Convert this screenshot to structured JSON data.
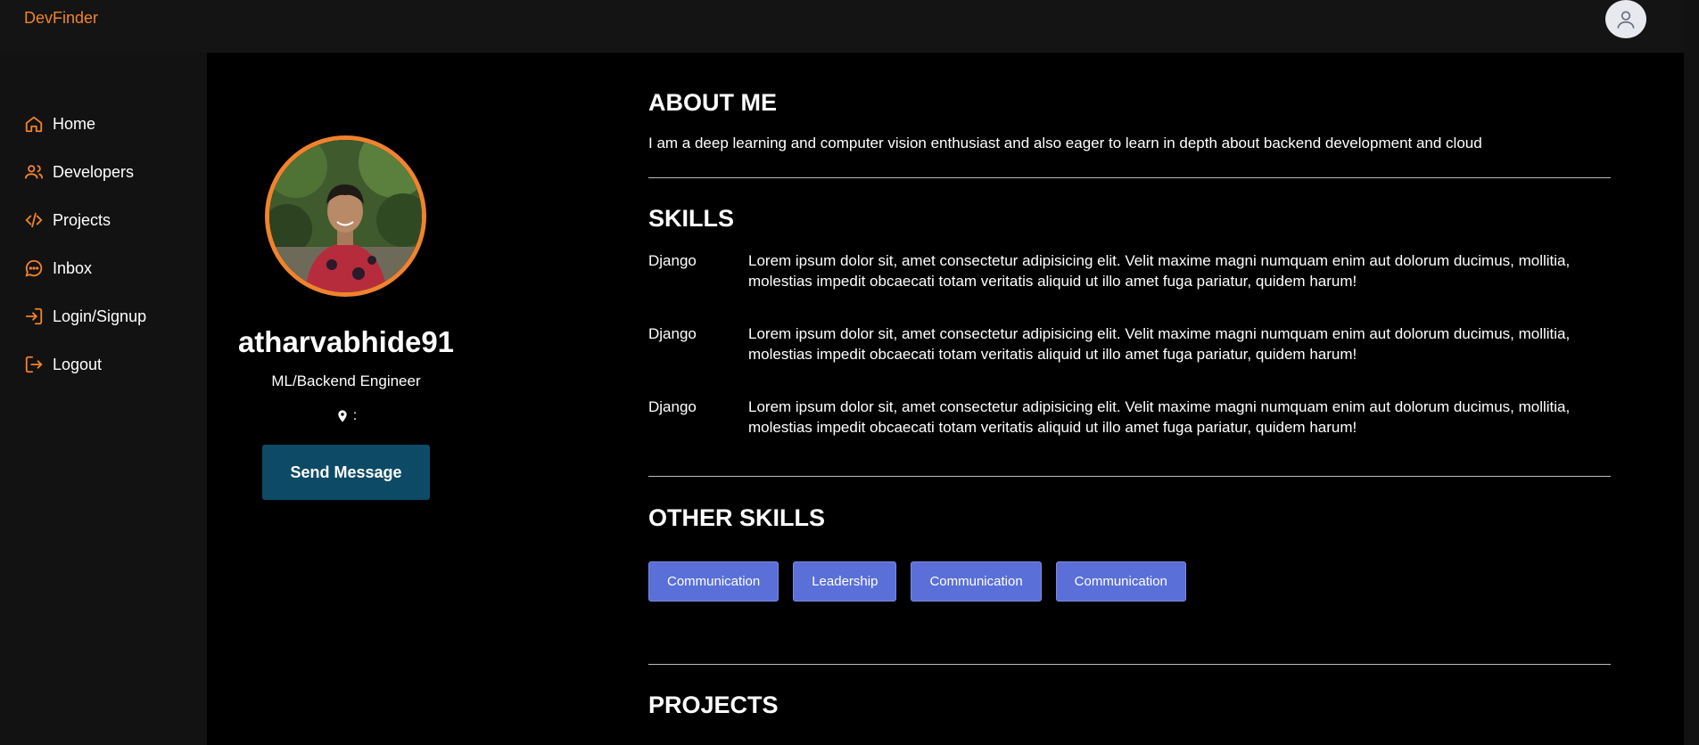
{
  "app": {
    "brand": "DevFinder"
  },
  "sidebar": {
    "items": [
      {
        "label": "Home",
        "icon": "home-icon"
      },
      {
        "label": "Developers",
        "icon": "users-icon"
      },
      {
        "label": "Projects",
        "icon": "code-icon"
      },
      {
        "label": "Inbox",
        "icon": "chat-icon"
      },
      {
        "label": "Login/Signup",
        "icon": "login-icon"
      },
      {
        "label": "Logout",
        "icon": "logout-icon"
      }
    ]
  },
  "profile": {
    "username": "atharvabhide91",
    "role": "ML/Backend Engineer",
    "location": ":",
    "send_button": "Send Message"
  },
  "about": {
    "title": "ABOUT ME",
    "text": "I am a deep learning and computer vision enthusiast and also eager to learn in depth about backend development and cloud"
  },
  "skills": {
    "title": "SKILLS",
    "items": [
      {
        "name": "Django",
        "description": "Lorem ipsum dolor sit, amet consectetur adipisicing elit. Velit maxime magni numquam enim aut dolorum ducimus, mollitia, molestias impedit obcaecati totam veritatis aliquid ut illo amet fuga pariatur, quidem harum!"
      },
      {
        "name": "Django",
        "description": "Lorem ipsum dolor sit, amet consectetur adipisicing elit. Velit maxime magni numquam enim aut dolorum ducimus, mollitia, molestias impedit obcaecati totam veritatis aliquid ut illo amet fuga pariatur, quidem harum!"
      },
      {
        "name": "Django",
        "description": "Lorem ipsum dolor sit, amet consectetur adipisicing elit. Velit maxime magni numquam enim aut dolorum ducimus, mollitia, molestias impedit obcaecati totam veritatis aliquid ut illo amet fuga pariatur, quidem harum!"
      }
    ]
  },
  "other_skills": {
    "title": "OTHER SKILLS",
    "items": [
      "Communication",
      "Leadership",
      "Communication",
      "Communication"
    ]
  },
  "projects": {
    "title": "PROJECTS"
  },
  "colors": {
    "accent": "#f0832d",
    "button": "#0d4a66",
    "chip": "#5a6fd8"
  }
}
